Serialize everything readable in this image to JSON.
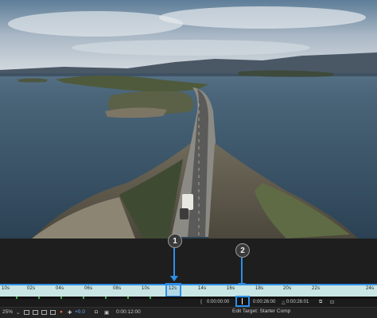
{
  "viewer": {
    "description_icon": "video-frame"
  },
  "callouts": [
    {
      "number": "1"
    },
    {
      "number": "2"
    }
  ],
  "timeline": {
    "ticks": [
      "10s",
      "02s",
      "04s",
      "06s",
      "08s",
      "10s",
      "12s",
      "14s",
      "16s",
      "18s",
      "20s",
      "22s",
      "24s"
    ],
    "current_label": "12s"
  },
  "transport": {
    "in_time": "0:00:00:00",
    "current_time": "0:00:26:00",
    "duration": "0:00:26:01",
    "delta_icon": "triangle-icon"
  },
  "status": {
    "zoom": "25%",
    "offset": "+0.0",
    "timecode": "0:00:12:00",
    "edit_target": "Edit Target: Starter Comp"
  },
  "colors": {
    "accent": "#2f8fe8",
    "ruler": "#c9e6e4",
    "green": "#3cb043"
  }
}
